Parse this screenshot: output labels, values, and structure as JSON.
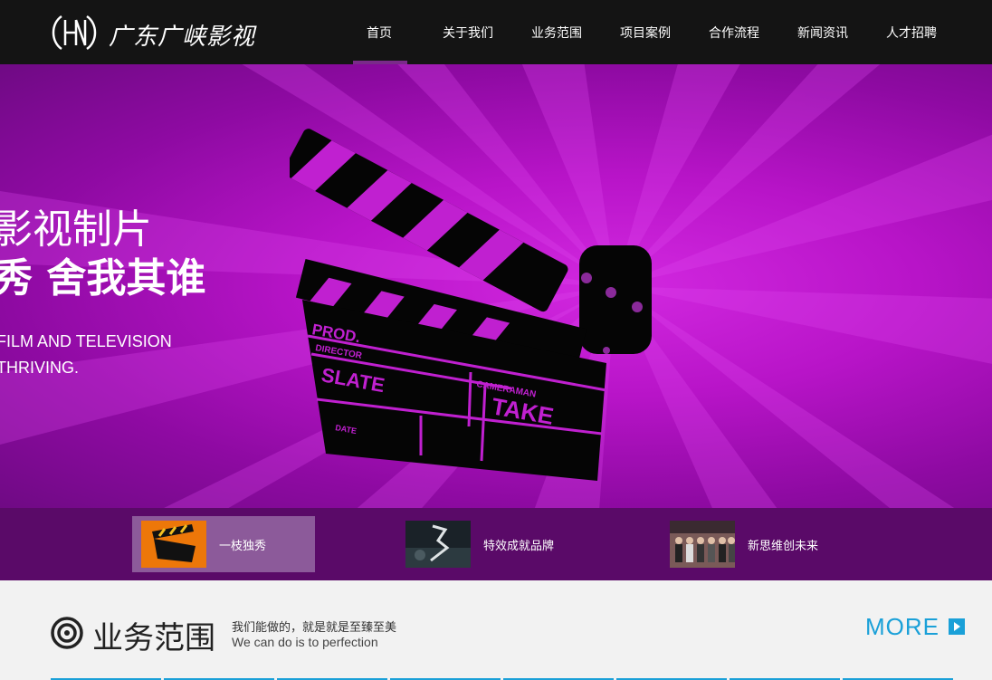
{
  "header": {
    "logo_text": "广东广峡影视",
    "nav": [
      {
        "label": "首页",
        "active": true
      },
      {
        "label": "关于我们",
        "active": false
      },
      {
        "label": "业务范围",
        "active": false
      },
      {
        "label": "项目案例",
        "active": false
      },
      {
        "label": "合作流程",
        "active": false
      },
      {
        "label": "新闻资讯",
        "active": false
      },
      {
        "label": "人才招聘",
        "active": false
      }
    ]
  },
  "banner": {
    "title_line1": "影视制片",
    "title_line2": "秀 舍我其谁",
    "english_line1": "FILM AND TELEVISION",
    "english_line2": "THRIVING.",
    "clapper": {
      "prod": "PROD.",
      "director": "DIRECTOR",
      "slate": "SLATE",
      "cameraman": "CAMERAMAN",
      "take": "TAKE",
      "date": "DATE"
    }
  },
  "thumbnails": [
    {
      "label": "一枝独秀",
      "active": true
    },
    {
      "label": "特效成就品牌",
      "active": false
    },
    {
      "label": "新思维创未来",
      "active": false
    }
  ],
  "section": {
    "title": "业务范围",
    "subtitle_cn": "我们能做的，就是就是至臻至美",
    "subtitle_en": "We can do is to perfection",
    "more_label": "MORE"
  },
  "colors": {
    "header_bg": "#141414",
    "banner_purple": "#b814c8",
    "strip_bg": "#5a0a68",
    "accent_blue": "#1aa0d8",
    "nav_active": "#7a2a8a"
  }
}
